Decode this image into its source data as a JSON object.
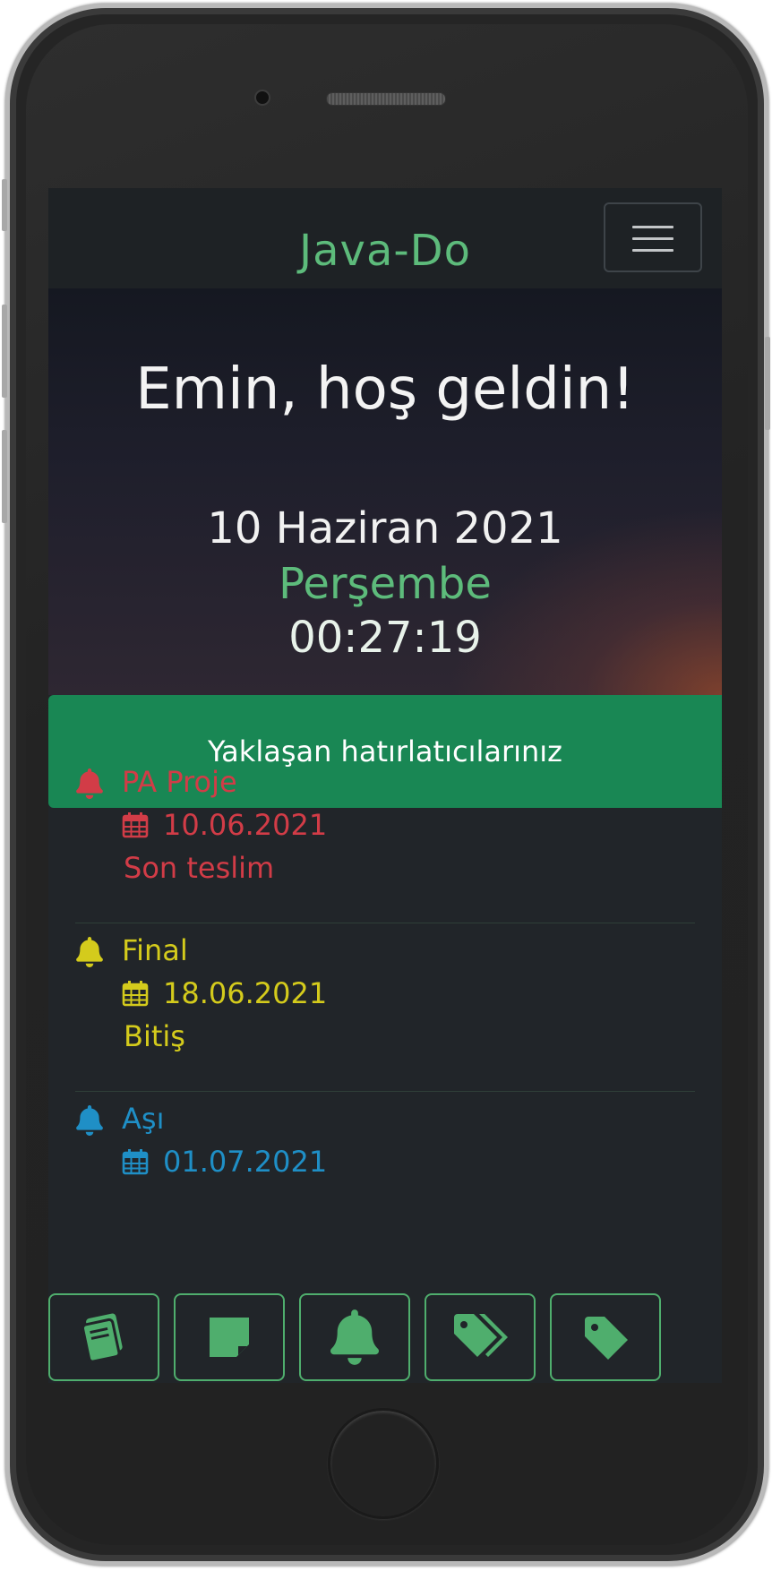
{
  "app": {
    "brand": "Java-Do",
    "accent_color": "#5dbb7b"
  },
  "hero": {
    "welcome": "Emin, hoş geldin!",
    "date": "10 Haziran 2021",
    "day": "Perşembe",
    "time": "00:27:19"
  },
  "banner": {
    "label": "Yaklaşan hatırlatıcılarınız",
    "color": "#198754"
  },
  "reminders": [
    {
      "title": "PA Proje",
      "date": "10.06.2021",
      "desc": "Son teslim",
      "color": "#d23c47",
      "icon": "bell-icon"
    },
    {
      "title": "Final",
      "date": "18.06.2021",
      "desc": "Bitiş",
      "color": "#d4cb1c",
      "icon": "bell-icon"
    },
    {
      "title": "Aşı",
      "date": "01.07.2021",
      "desc": "",
      "color": "#1f8fc6",
      "icon": "bell-icon"
    }
  ],
  "bottom_nav": [
    {
      "icon": "book-icon"
    },
    {
      "icon": "sticky-note-icon"
    },
    {
      "icon": "bell-icon"
    },
    {
      "icon": "tags-icon"
    },
    {
      "icon": "tag-icon"
    }
  ]
}
